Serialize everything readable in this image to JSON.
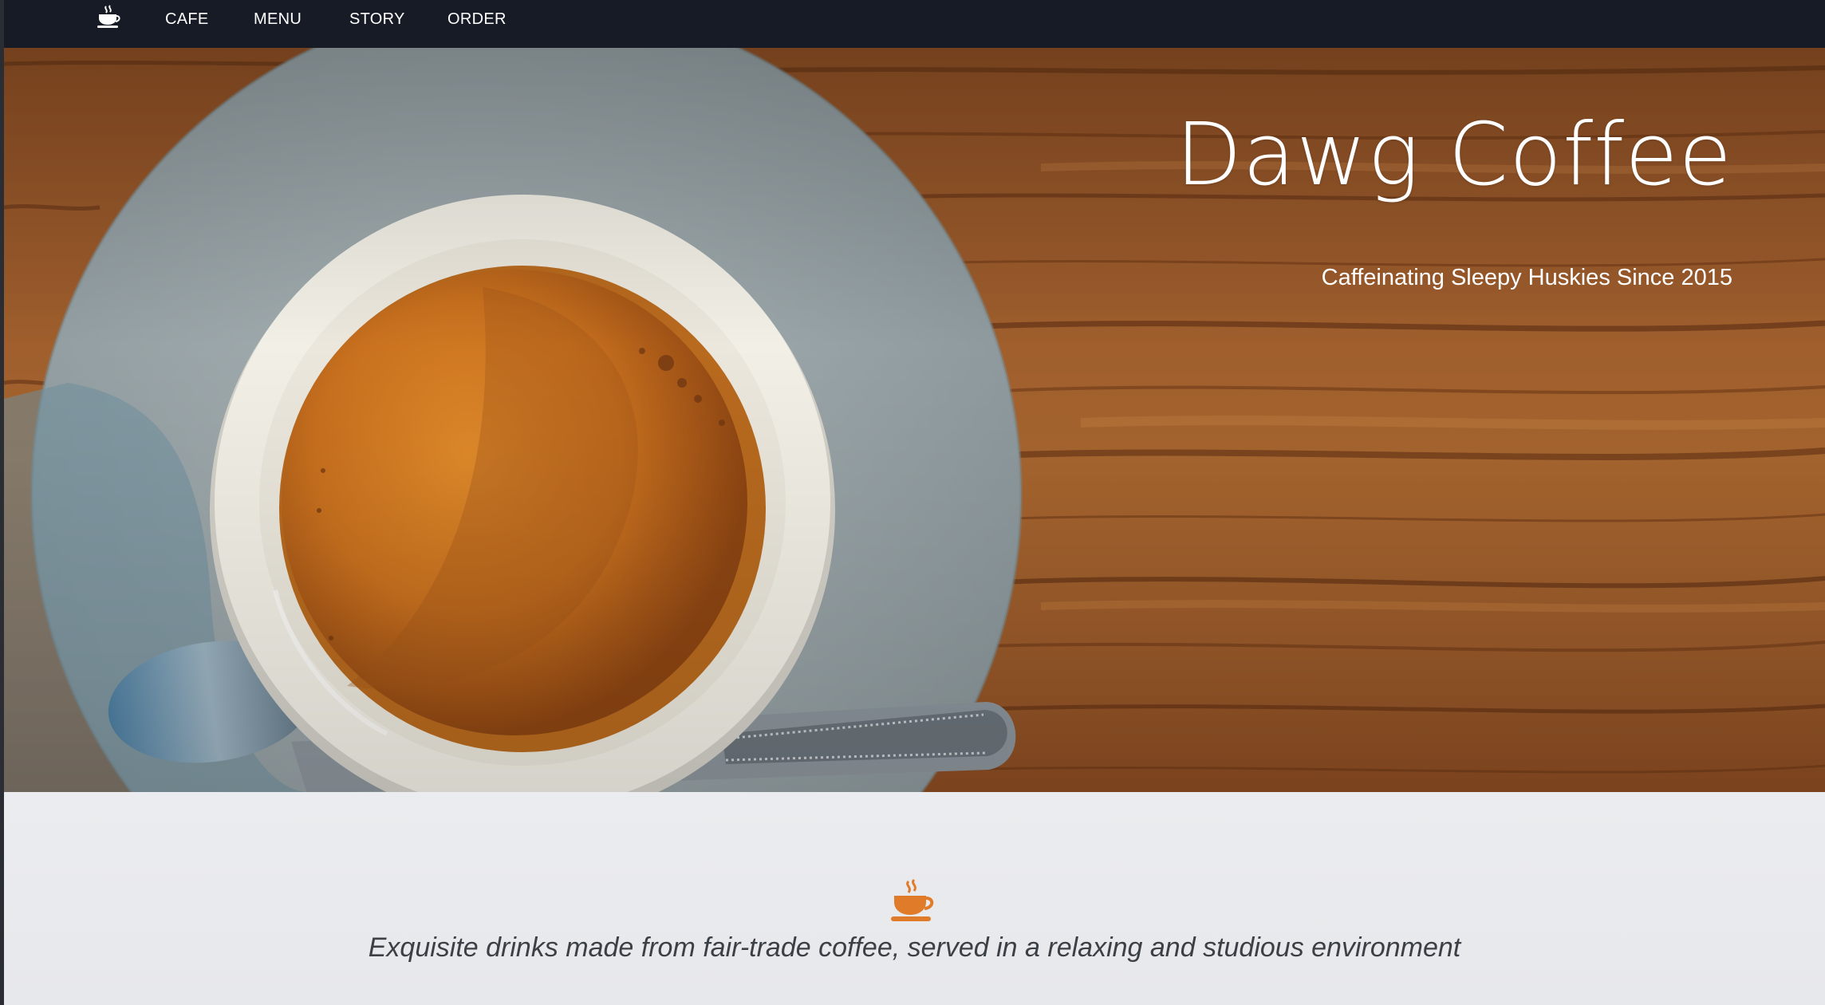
{
  "nav": {
    "logo_icon": "coffee-cup-icon",
    "items": [
      {
        "label": "CAFE"
      },
      {
        "label": "MENU"
      },
      {
        "label": "STORY"
      },
      {
        "label": "ORDER"
      }
    ]
  },
  "hero": {
    "title": "Dawg Coffee",
    "subtitle": "Caffeinating Sleepy Huskies Since 2015"
  },
  "about": {
    "icon": "coffee-cup-icon",
    "icon_color": "#e07b2a",
    "tagline": "Exquisite drinks made from fair-trade coffee, served in a relaxing and studious environment"
  },
  "colors": {
    "navbar": "#161b26",
    "accent": "#e07b2a",
    "section_bg": "#e9eaed"
  }
}
